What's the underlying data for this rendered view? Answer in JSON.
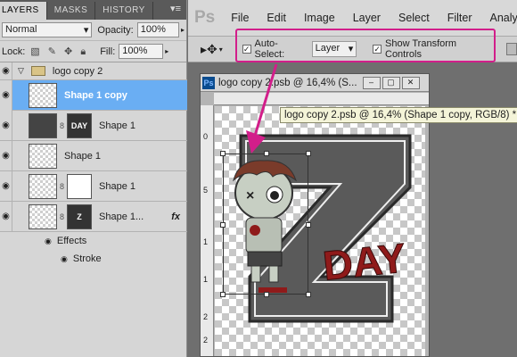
{
  "layers_panel": {
    "tabs": [
      "LAYERS",
      "MASKS",
      "HISTORY"
    ],
    "blend_mode": "Normal",
    "opacity_label": "Opacity:",
    "opacity_value": "100%",
    "lock_label": "Lock:",
    "fill_label": "Fill:",
    "fill_value": "100%",
    "group_name": "logo copy 2",
    "layers": [
      {
        "name": "Shape 1 copy"
      },
      {
        "name": "Shape 1",
        "mask_text": "DAY"
      },
      {
        "name": "Shape 1"
      },
      {
        "name": "Shape 1"
      },
      {
        "name": "Shape 1..."
      }
    ],
    "effects_label": "Effects",
    "stroke_label": "Stroke",
    "fx_label": "fx"
  },
  "menubar": {
    "logo": "Ps",
    "items": [
      "File",
      "Edit",
      "Image",
      "Layer",
      "Select",
      "Filter",
      "Analysis"
    ]
  },
  "options": {
    "auto_select_label": "Auto-Select:",
    "auto_select_value": "Layer",
    "show_transform_label": "Show Transform Controls"
  },
  "document": {
    "title": "logo copy 2.psb @ 16,4% (S...",
    "ps_badge": "Ps",
    "tooltip": "logo copy 2.psb @ 16,4% (Shape 1 copy, RGB/8) *",
    "vruler_labels": [
      "0",
      "5",
      "1",
      "1",
      "2",
      "2"
    ],
    "art_text": "DAY"
  },
  "colors": {
    "highlight": "#d21e8a",
    "selection": "#6aaef3",
    "art_red": "#8f1a1a",
    "art_gray": "#5a5a5a"
  }
}
